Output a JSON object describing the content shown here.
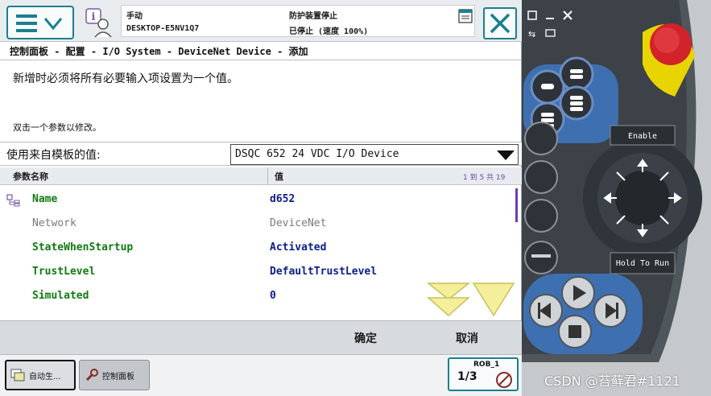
{
  "topbar": {
    "mode": "手动",
    "host": "DESKTOP-E5NV1Q7",
    "safety_status": "防护装置停止",
    "run_status": "已停止 (速度 100%)"
  },
  "breadcrumb": "控制面板 - 配置 - I/O System - DeviceNet Device - 添加",
  "messages": {
    "required": "新增时必须将所有必要输入项设置为一个值。",
    "hint": "双击一个参数以修改。"
  },
  "template": {
    "label": "使用来自模板的值:",
    "selected": "DSQC 652 24 VDC I/O Device"
  },
  "table": {
    "col_name": "参数名称",
    "col_value": "值",
    "page_info": "1 到 5 共 19",
    "rows": [
      {
        "name": "Name",
        "value": "d652"
      },
      {
        "name": "Network",
        "value": "DeviceNet"
      },
      {
        "name": "StateWhenStartup",
        "value": "Activated"
      },
      {
        "name": "TrustLevel",
        "value": "DefaultTrustLevel"
      },
      {
        "name": "Simulated",
        "value": "0"
      }
    ]
  },
  "actions": {
    "ok": "确定",
    "cancel": "取消"
  },
  "taskbar": {
    "auto": "自动生...",
    "control_panel": "控制面板",
    "rob_label": "ROB_1",
    "rob_fraction": "1/3"
  },
  "pendant": {
    "enable_label": "Enable",
    "hold_label": "Hold To Run"
  },
  "watermark": "CSDN @苔藓君#1121",
  "colors": {
    "accent_teal": "#1b7f8f",
    "param_green": "#0f7a0f",
    "value_blue": "#0b1e8c",
    "pendant_blue": "#3e6fb0",
    "estop_red": "#d2222a",
    "estop_yellow": "#e8d400"
  }
}
